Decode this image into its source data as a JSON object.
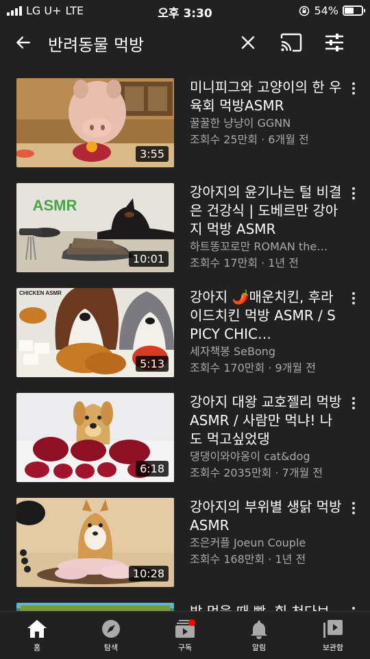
{
  "status": {
    "carrier": "LG U+",
    "network": "LTE",
    "time": "오후 3:30",
    "battery_percent": "54%",
    "battery_level": 0.54
  },
  "app_bar": {
    "query": "반려동물 먹방",
    "icons": [
      "back-arrow-icon",
      "close-icon",
      "cast-icon",
      "filter-icon"
    ]
  },
  "videos": [
    {
      "title": "미니피그와 고양이의 한 우육회 먹방ASMR",
      "channel": "꿀꿀한 냥냥이 GGNN",
      "stats": "조회수 25만회 · 6개월 전",
      "duration": "3:55"
    },
    {
      "title": "강아지의 윤기나는 털 비결은 건강식 | 도베르만 강아지 먹방 ASMR",
      "channel": "하트똥꼬로만 ROMAN the…",
      "stats": "조회수 17만회 · 1년 전",
      "duration": "10:01"
    },
    {
      "title": "강아지 🌶️매운치킨, 후라이드치킨 먹방 ASMR / SPICY CHIC…",
      "channel": "세자책봉 SeBong",
      "stats": "조회수 170만회 · 9개월 전",
      "duration": "5:13"
    },
    {
      "title": "강아지 대왕 교호젤리 먹방ASMR / 사람만 먹냐! 나도 먹고싶었댕",
      "channel": "댕댕이와야옹이 cat&dog",
      "stats": "조회수 2035만회 · 7개월 전",
      "duration": "6:18"
    },
    {
      "title": "강아지의 부위별 생닭 먹방 ASMR",
      "channel": "조은커플 Joeun Couple",
      "stats": "조회수 168만회 · 1년 전",
      "duration": "10:28"
    },
    {
      "title": "밥 먹을 때 빵, 힘 천다보",
      "channel": "",
      "stats": "",
      "duration": ""
    }
  ],
  "thumb_labels": {
    "asmr": "ASMR",
    "chicken_asmr": "CHICKEN ASMR"
  },
  "nav": {
    "items": [
      {
        "label": "홈",
        "icon": "home-icon"
      },
      {
        "label": "탐색",
        "icon": "explore-icon"
      },
      {
        "label": "구독",
        "icon": "subscriptions-icon"
      },
      {
        "label": "알림",
        "icon": "bell-icon"
      },
      {
        "label": "보관함",
        "icon": "library-icon"
      }
    ]
  },
  "colors": {
    "background": "#212121",
    "secondary_text": "#aaaaaa",
    "notification_dot": "#ff0000"
  }
}
